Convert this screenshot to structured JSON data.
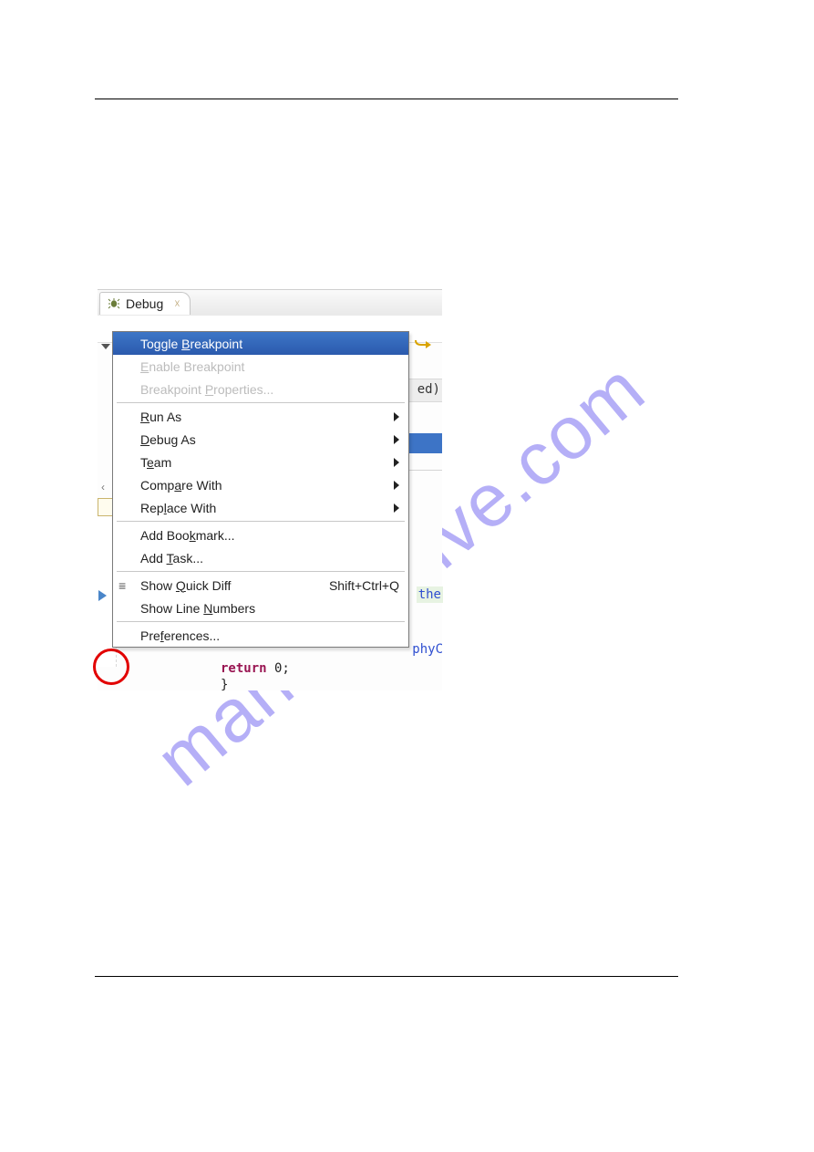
{
  "watermark": "manualshive.com",
  "tab": {
    "title": "Debug",
    "close_glyph": "☓"
  },
  "context_menu": {
    "items": {
      "toggle_breakpoint": {
        "pre": "Toggle ",
        "u": "B",
        "post": "reakpoint"
      },
      "enable_breakpoint": {
        "pre": "",
        "u": "E",
        "post": "nable Breakpoint"
      },
      "breakpoint_props": {
        "pre": "Breakpoint ",
        "u": "P",
        "post": "roperties..."
      },
      "run_as": {
        "pre": "",
        "u": "R",
        "post": "un As"
      },
      "debug_as": {
        "pre": "",
        "u": "D",
        "post": "ebug As"
      },
      "team": {
        "pre": "T",
        "u": "e",
        "post": "am"
      },
      "compare_with": {
        "pre": "Comp",
        "u": "a",
        "post": "re With"
      },
      "replace_with": {
        "pre": "Rep",
        "u": "l",
        "post": "ace With"
      },
      "add_bookmark": {
        "pre": "Add Boo",
        "u": "k",
        "post": "mark..."
      },
      "add_task": {
        "pre": "Add ",
        "u": "T",
        "post": "ask..."
      },
      "show_quick_diff": {
        "pre": "Show ",
        "u": "Q",
        "post": "uick Diff",
        "shortcut": "Shift+Ctrl+Q"
      },
      "show_line_numbers": {
        "pre": "Show Line ",
        "u": "N",
        "post": "umbers"
      },
      "preferences": {
        "pre": "Pre",
        "u": "f",
        "post": "erences..."
      }
    }
  },
  "editor": {
    "behind_text_ed": "ed)",
    "snip_the": "the",
    "snip_phy": "phyC",
    "return_kw": "return",
    "return_rest": " 0;",
    "brace": "}",
    "scroll_left_glyph": "‹"
  }
}
